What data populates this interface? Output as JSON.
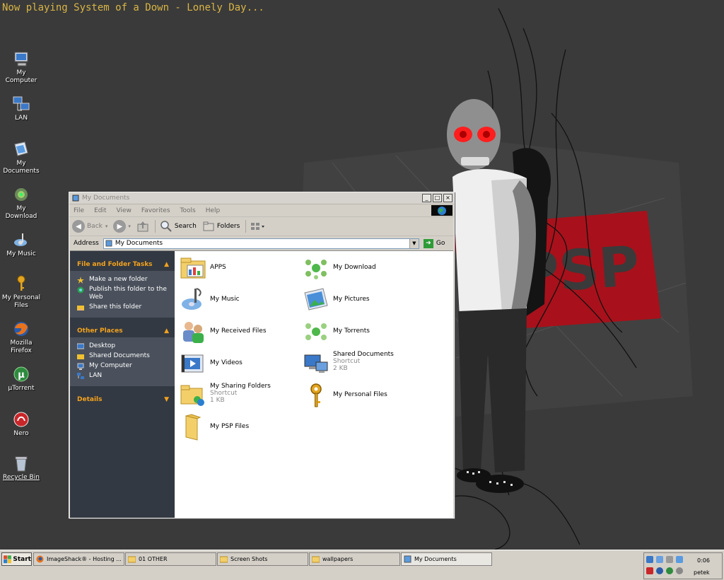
{
  "desktop": {
    "now_playing": "Now playing System of a Down - Lonely Day...",
    "icons": [
      {
        "label": "My Computer"
      },
      {
        "label": "LAN"
      },
      {
        "label": "My Documents"
      },
      {
        "label": "My Download"
      },
      {
        "label": "My Music"
      },
      {
        "label": "My Personal Files"
      },
      {
        "label": "Mozilla Firefox"
      },
      {
        "label": "µTorrent"
      },
      {
        "label": "Nero"
      },
      {
        "label": "Recycle Bin"
      }
    ]
  },
  "window": {
    "title": "My Documents",
    "controls": {
      "minimize": "_",
      "maximize": "□",
      "close": "×"
    },
    "menu": [
      "File",
      "Edit",
      "View",
      "Favorites",
      "Tools",
      "Help"
    ],
    "toolbar": {
      "back": "Back",
      "search": "Search",
      "folders": "Folders"
    },
    "address": {
      "label": "Address",
      "value": "My Documents",
      "go": "Go"
    },
    "tasks": {
      "file_folder": {
        "title": "File and Folder Tasks",
        "items": [
          "Make a new folder",
          "Publish this folder to the Web",
          "Share this folder"
        ]
      },
      "other_places": {
        "title": "Other Places",
        "items": [
          "Desktop",
          "Shared Documents",
          "My Computer",
          "LAN"
        ]
      },
      "details": {
        "title": "Details"
      }
    },
    "files": [
      {
        "name": "APPS",
        "sub1": "",
        "sub2": "",
        "icon": "apps-folder-icon"
      },
      {
        "name": "My Download",
        "sub1": "",
        "sub2": "",
        "icon": "download-icon"
      },
      {
        "name": "My Music",
        "sub1": "",
        "sub2": "",
        "icon": "music-icon"
      },
      {
        "name": "My Pictures",
        "sub1": "",
        "sub2": "",
        "icon": "pictures-icon"
      },
      {
        "name": "My Received Files",
        "sub1": "",
        "sub2": "",
        "icon": "received-files-icon"
      },
      {
        "name": "My Torrents",
        "sub1": "",
        "sub2": "",
        "icon": "torrents-icon"
      },
      {
        "name": "My Videos",
        "sub1": "",
        "sub2": "",
        "icon": "videos-icon"
      },
      {
        "name": "Shared Documents",
        "sub1": "Shortcut",
        "sub2": "2 KB",
        "icon": "shared-documents-icon"
      },
      {
        "name": "My Sharing Folders",
        "sub1": "Shortcut",
        "sub2": "1 KB",
        "icon": "sharing-folders-icon"
      },
      {
        "name": "My Personal Files",
        "sub1": "",
        "sub2": "",
        "icon": "key-icon"
      },
      {
        "name": "My PSP Files",
        "sub1": "",
        "sub2": "",
        "icon": "psp-folder-icon"
      }
    ]
  },
  "taskbar": {
    "start": "Start",
    "buttons": [
      {
        "label": "ImageShack® - Hosting ..."
      },
      {
        "label": "01 OTHER"
      },
      {
        "label": "Screen Shots"
      },
      {
        "label": "wallpapers"
      },
      {
        "label": "My Documents"
      }
    ],
    "clock": "0:06",
    "day": "petek"
  },
  "colors": {
    "task_panel": "#333942",
    "panel_header": "#f3a21e",
    "wallpaper_red": "#a8111b",
    "now_playing": "#d9b545"
  }
}
